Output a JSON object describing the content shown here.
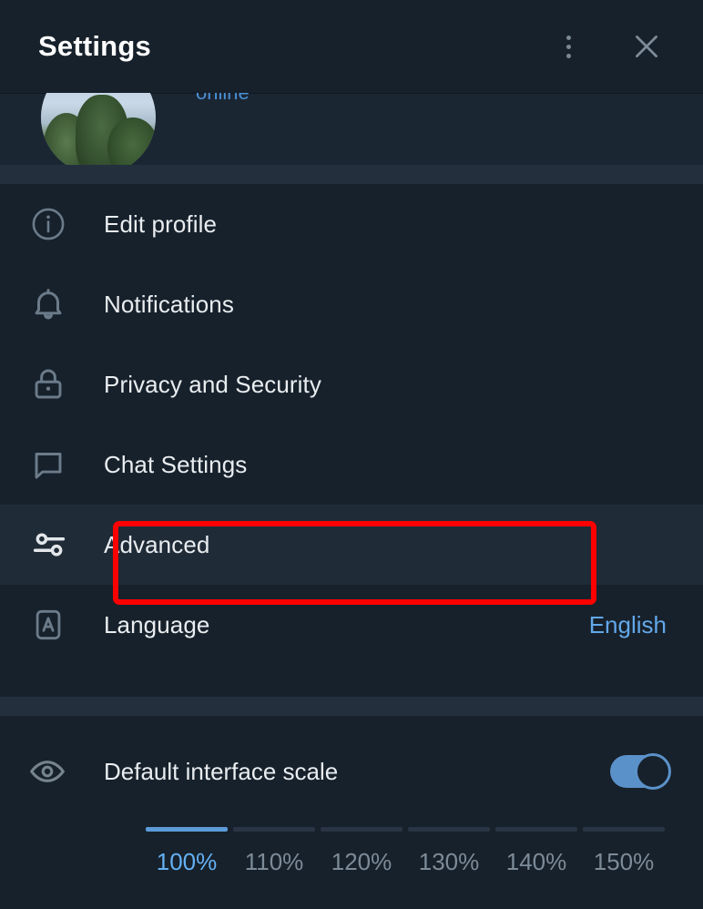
{
  "header": {
    "title": "Settings",
    "menu_icon": "more-vertical-icon",
    "close_icon": "close-icon"
  },
  "profile": {
    "status": "online",
    "avatar_icon": "user-avatar-photo"
  },
  "menu": {
    "items": [
      {
        "icon": "info-circle-icon",
        "label": "Edit profile",
        "value": "",
        "active": false
      },
      {
        "icon": "bell-icon",
        "label": "Notifications",
        "value": "",
        "active": false
      },
      {
        "icon": "lock-icon",
        "label": "Privacy and Security",
        "value": "",
        "active": false
      },
      {
        "icon": "chat-bubble-icon",
        "label": "Chat Settings",
        "value": "",
        "active": false
      },
      {
        "icon": "sliders-icon",
        "label": "Advanced",
        "value": "",
        "active": true
      },
      {
        "icon": "language-a-icon",
        "label": "Language",
        "value": "English",
        "active": false
      }
    ]
  },
  "scale": {
    "icon": "eye-icon",
    "label": "Default interface scale",
    "toggle_on": true,
    "options": [
      "100%",
      "110%",
      "120%",
      "130%",
      "140%",
      "150%"
    ],
    "selected_index": 0,
    "selected_value": "100%"
  },
  "annotation": {
    "target": "Advanced",
    "color": "#fe0000"
  },
  "colors": {
    "background": "#17212b",
    "surface": "#1b2633",
    "divider": "#242f3d",
    "active_row": "#202b38",
    "accent": "#62a8ea",
    "toggle_on": "#5b91c9",
    "text_primary": "#e9edf0",
    "text_muted": "#7d8b98",
    "highlight": "#fe0000"
  }
}
